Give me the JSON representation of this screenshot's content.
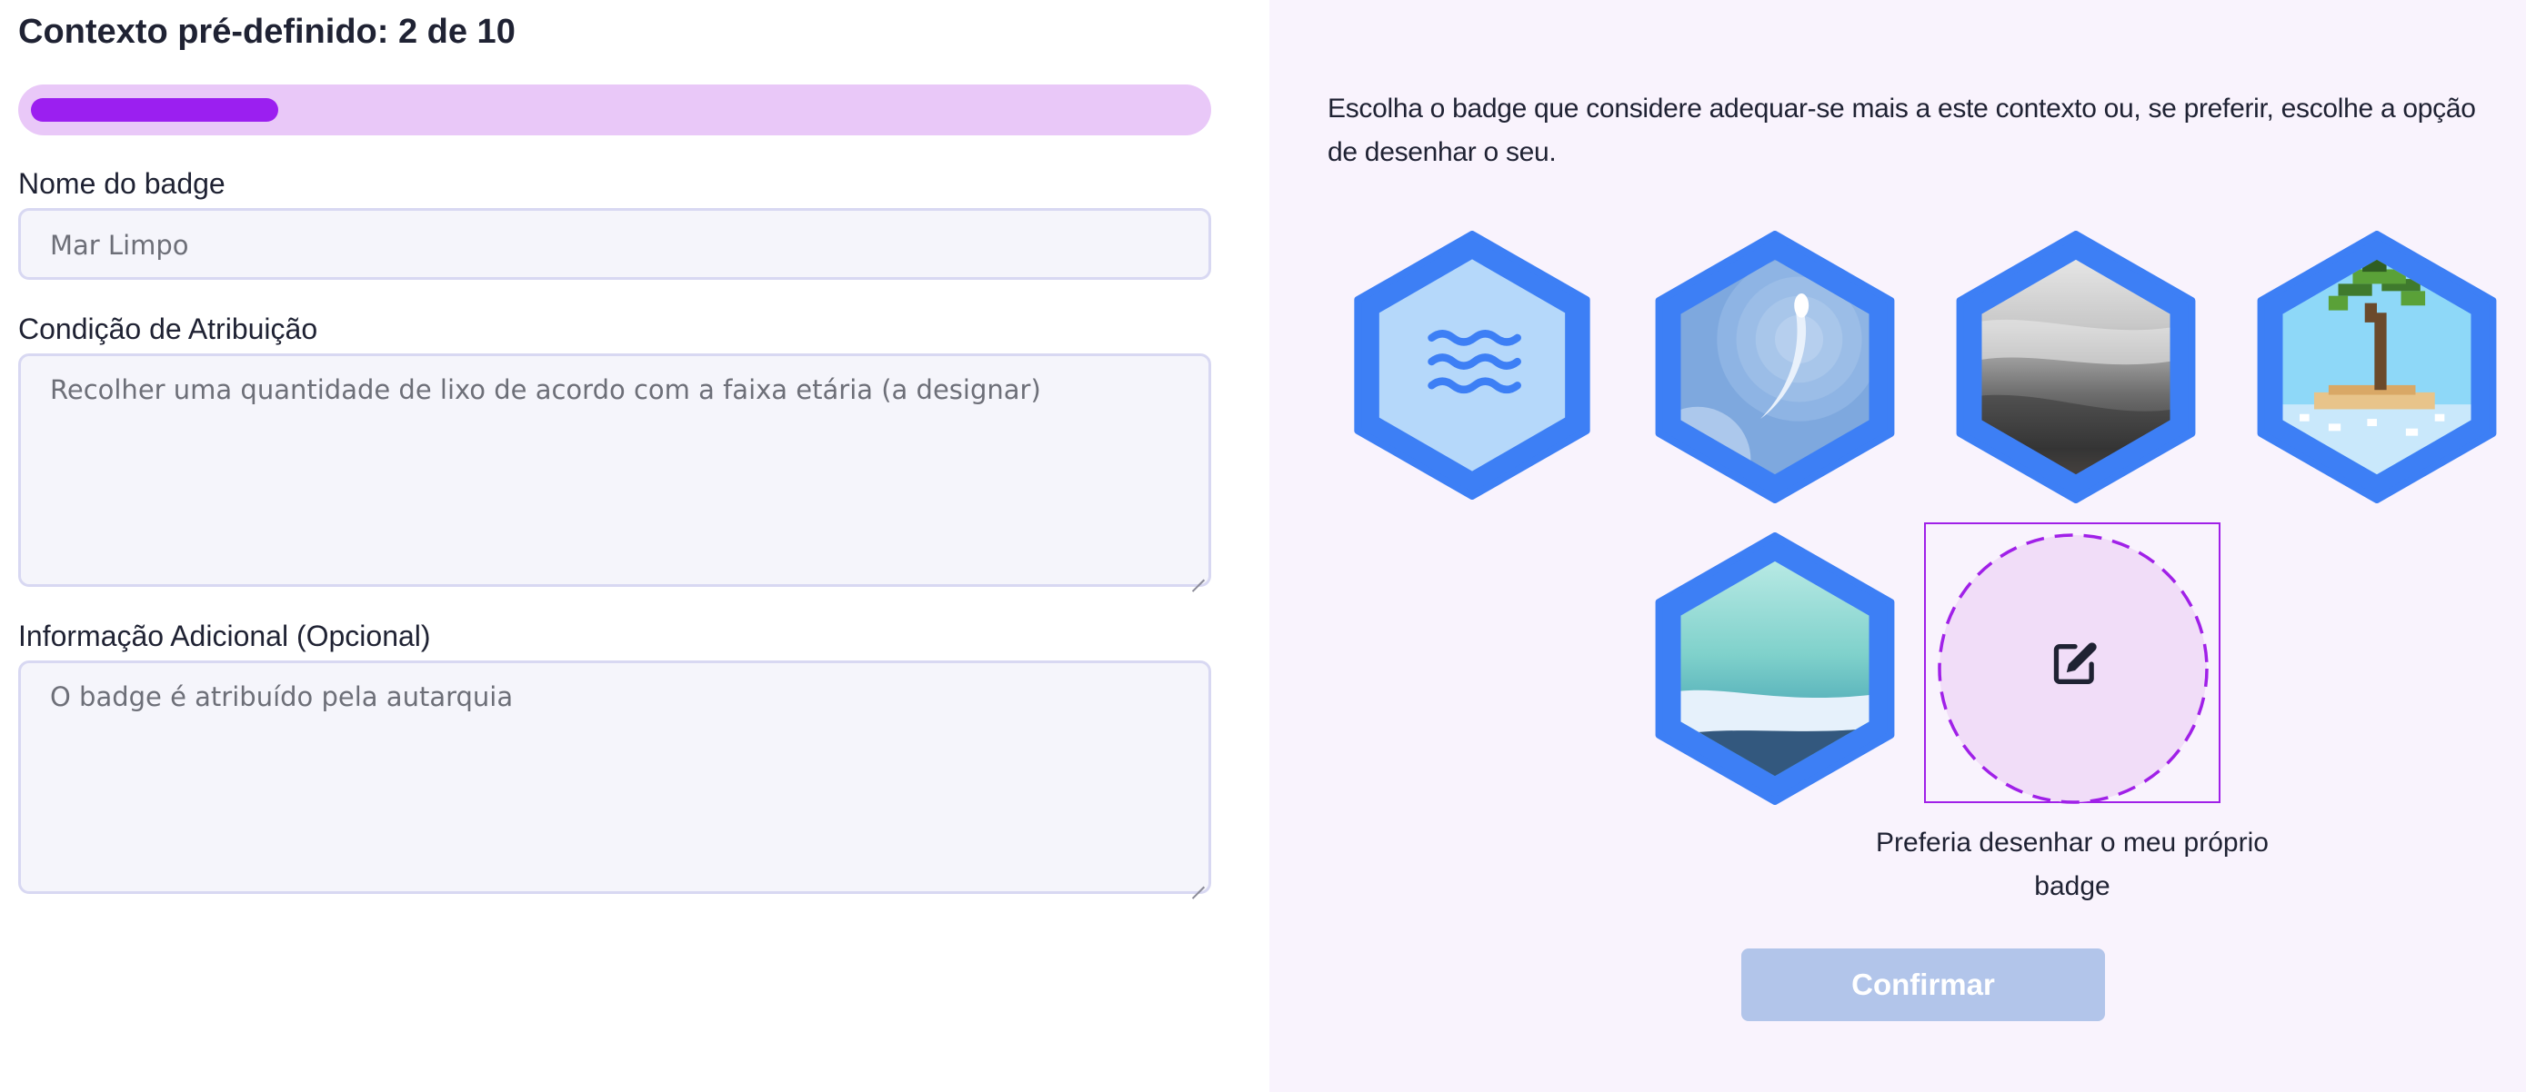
{
  "form": {
    "title": "Contexto pré-definido: 2 de 10",
    "progress": {
      "current": 2,
      "total": 10,
      "fraction": 0.2
    },
    "badge_name": {
      "label": "Nome do badge",
      "placeholder": "Mar Limpo"
    },
    "condition": {
      "label": "Condição de Atribuição",
      "placeholder": "Recolher uma quantidade de lixo de acordo com a faixa etária (a designar)"
    },
    "additional_info": {
      "label": "Informação Adicional (Opcional)",
      "placeholder": "O badge é atribuído pela autarquia"
    }
  },
  "badge_picker": {
    "instructions": "Escolha o badge que considere adequar-se mais a este contexto ou, se preferir, escolhe a opção de desenhar o seu.",
    "badges": [
      {
        "icon": "waves-icon"
      },
      {
        "icon": "swirl-image"
      },
      {
        "icon": "grey-sand-image"
      },
      {
        "icon": "palm-island-icon"
      },
      {
        "icon": "beach-shore-image"
      }
    ],
    "draw_own": {
      "label": "Preferia desenhar o meu próprio badge",
      "icon": "edit-icon"
    }
  },
  "actions": {
    "confirm_label": "Confirmar"
  },
  "colors": {
    "accent": "#9b1ff0",
    "progress_track": "#e9c8f8",
    "badge_frame": "#3d7ff5",
    "confirm_disabled": "#b2c5ea",
    "right_panel_bg": "#f9f3fd"
  }
}
